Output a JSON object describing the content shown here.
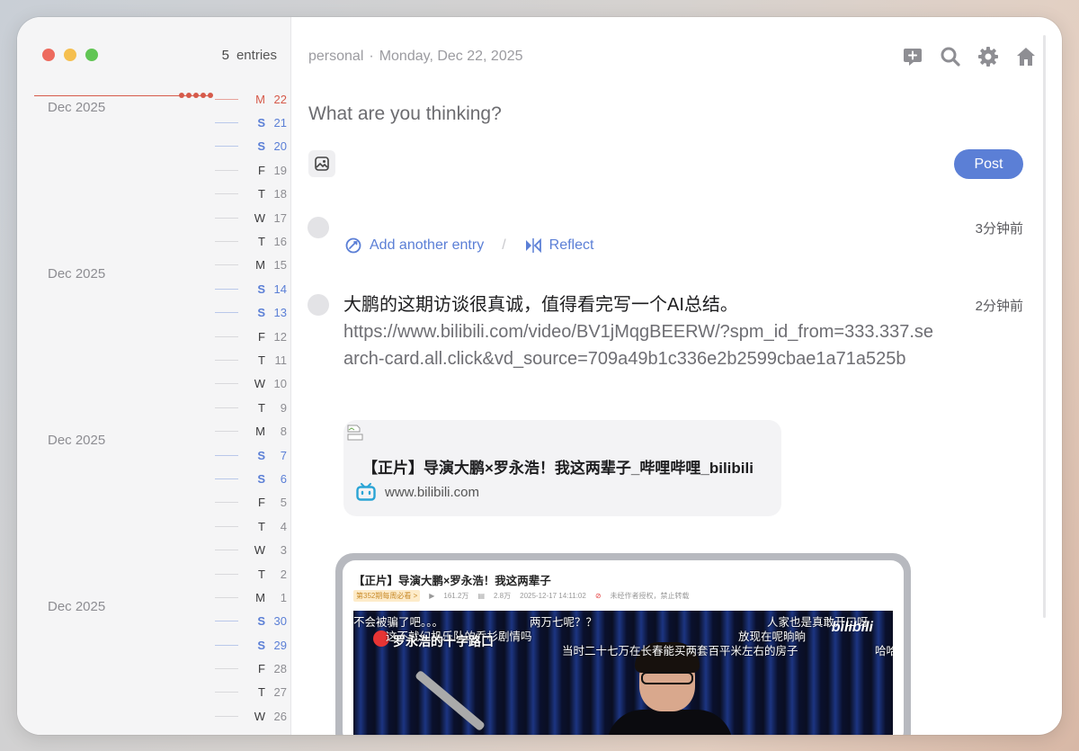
{
  "sidebar": {
    "entries_count": "5",
    "entries_label": "entries",
    "months": [
      "Dec 2025",
      "Dec 2025",
      "Dec 2025",
      "Dec 2025"
    ],
    "days": [
      {
        "wd": "M",
        "dn": "22",
        "kind": "today"
      },
      {
        "wd": "S",
        "dn": "21",
        "kind": "weekend"
      },
      {
        "wd": "S",
        "dn": "20",
        "kind": "weekend"
      },
      {
        "wd": "F",
        "dn": "19",
        "kind": "weekday"
      },
      {
        "wd": "T",
        "dn": "18",
        "kind": "weekday"
      },
      {
        "wd": "W",
        "dn": "17",
        "kind": "weekday"
      },
      {
        "wd": "T",
        "dn": "16",
        "kind": "weekday"
      },
      {
        "wd": "M",
        "dn": "15",
        "kind": "weekday"
      },
      {
        "wd": "S",
        "dn": "14",
        "kind": "weekend"
      },
      {
        "wd": "S",
        "dn": "13",
        "kind": "weekend"
      },
      {
        "wd": "F",
        "dn": "12",
        "kind": "weekday"
      },
      {
        "wd": "T",
        "dn": "11",
        "kind": "weekday"
      },
      {
        "wd": "W",
        "dn": "10",
        "kind": "weekday"
      },
      {
        "wd": "T",
        "dn": "9",
        "kind": "weekday"
      },
      {
        "wd": "M",
        "dn": "8",
        "kind": "weekday"
      },
      {
        "wd": "S",
        "dn": "7",
        "kind": "weekend"
      },
      {
        "wd": "S",
        "dn": "6",
        "kind": "weekend"
      },
      {
        "wd": "F",
        "dn": "5",
        "kind": "weekday"
      },
      {
        "wd": "T",
        "dn": "4",
        "kind": "weekday"
      },
      {
        "wd": "W",
        "dn": "3",
        "kind": "weekday"
      },
      {
        "wd": "T",
        "dn": "2",
        "kind": "weekday"
      },
      {
        "wd": "M",
        "dn": "1",
        "kind": "weekday"
      },
      {
        "wd": "S",
        "dn": "30",
        "kind": "weekend"
      },
      {
        "wd": "S",
        "dn": "29",
        "kind": "weekend"
      },
      {
        "wd": "F",
        "dn": "28",
        "kind": "weekday"
      },
      {
        "wd": "T",
        "dn": "27",
        "kind": "weekday"
      },
      {
        "wd": "W",
        "dn": "26",
        "kind": "weekday"
      }
    ]
  },
  "header": {
    "journal": "personal",
    "separator": "·",
    "date": "Monday, Dec 22, 2025",
    "icons": [
      "new-entry-icon",
      "search-icon",
      "gear-icon",
      "home-icon"
    ]
  },
  "composer": {
    "placeholder": "What are you thinking?",
    "post_label": "Post"
  },
  "thread": {
    "time1": "3分钟前",
    "add_entry_label": "Add another entry",
    "action_sep": "/",
    "reflect_label": "Reflect",
    "time2": "2分钟前",
    "entry_text": "大鹏的这期访谈很真诚，值得看完写一个AI总结。",
    "entry_link": "https://www.bilibili.com/video/BV1jMqgBEERW/?spm_id_from=333.337.search-card.all.click&vd_source=709a49b1c336e2b2599cbae1a71a525b",
    "card_title": "【正片】导演大鹏×罗永浩！我这两辈子_哔哩哔哩_bilibili",
    "card_site": "www.bilibili.com"
  },
  "screenshot": {
    "title": "【正片】导演大鹏×罗永浩！我这两辈子",
    "meta_tag": "第352期每周必看 >",
    "meta_views": "161.2万",
    "meta_danmaku": "2.8万",
    "meta_time": "2025-12-17 14:11:02",
    "meta_warn": "未经作者授权，禁止转载",
    "danmaku": [
      "不会被骗了吧。。。",
      "这不就幻机乐队的乔杉剧情吗",
      "两万七呢？？",
      "人家也是真敢开口呀",
      "放现在呢晌晌",
      "当时二十七万在长春能买两套百平米左右的房子",
      "哈哈",
      "罗永浩的十字路口"
    ],
    "logo": "bilibili"
  },
  "colors": {
    "accent": "#5b7fd6",
    "today": "#d65a4a"
  }
}
